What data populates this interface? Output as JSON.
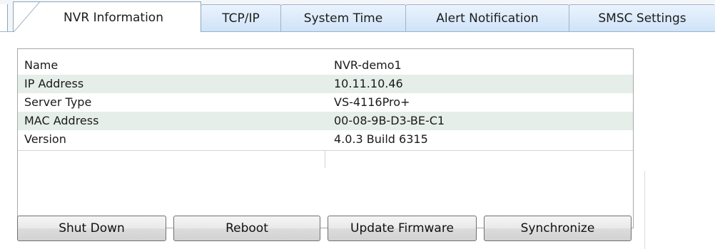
{
  "tabs": [
    {
      "label": "NVR Information",
      "active": true
    },
    {
      "label": "TCP/IP",
      "active": false
    },
    {
      "label": "System Time",
      "active": false
    },
    {
      "label": "Alert Notification",
      "active": false
    },
    {
      "label": "SMSC Settings",
      "active": false
    }
  ],
  "info": {
    "rows": [
      {
        "label": "Name",
        "value": "NVR-demo1"
      },
      {
        "label": "IP Address",
        "value": "10.11.10.46"
      },
      {
        "label": "Server Type",
        "value": "VS-4116Pro+"
      },
      {
        "label": "MAC Address",
        "value": "00-08-9B-D3-BE-C1"
      },
      {
        "label": "Version",
        "value": "4.0.3 Build 6315"
      }
    ]
  },
  "buttons": {
    "shutdown": "Shut Down",
    "reboot": "Reboot",
    "update_firmware": "Update Firmware",
    "synchronize": "Synchronize"
  },
  "colors": {
    "tab_gradient_top": "#eaf3fd",
    "tab_gradient_bottom": "#cfe3f8",
    "row_shade": "#e6eeea",
    "panel_border": "#a7a7a7"
  }
}
